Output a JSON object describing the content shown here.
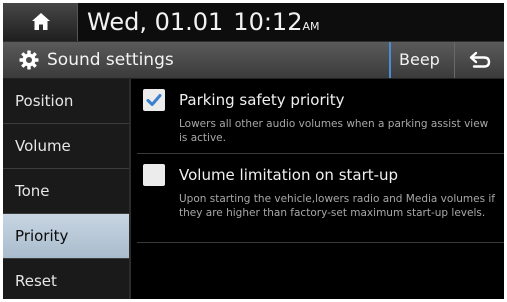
{
  "status": {
    "date": "Wed, 01.01",
    "time": "10:12",
    "ampm": "AM"
  },
  "icons": {
    "home": "home-icon",
    "settings": "gear-icon",
    "back": "back-arrow-icon",
    "check": "checkmark-icon"
  },
  "header": {
    "title": "Sound settings",
    "beep_label": "Beep"
  },
  "sidebar": {
    "items": [
      {
        "label": "Position",
        "active": false
      },
      {
        "label": "Volume",
        "active": false
      },
      {
        "label": "Tone",
        "active": false
      },
      {
        "label": "Priority",
        "active": true
      },
      {
        "label": "Reset",
        "active": false
      }
    ]
  },
  "options": [
    {
      "label": "Parking safety priority",
      "description": "Lowers all other audio volumes when a parking assist view is active.",
      "checked": true
    },
    {
      "label": "Volume limitation on start-up",
      "description": "Upon starting the vehicle,lowers radio and Media volumes if they are higher than factory-set maximum start-up levels.",
      "checked": false
    }
  ],
  "colors": {
    "accent": "#3b7fcf",
    "active_item": "#b7c8d8"
  }
}
